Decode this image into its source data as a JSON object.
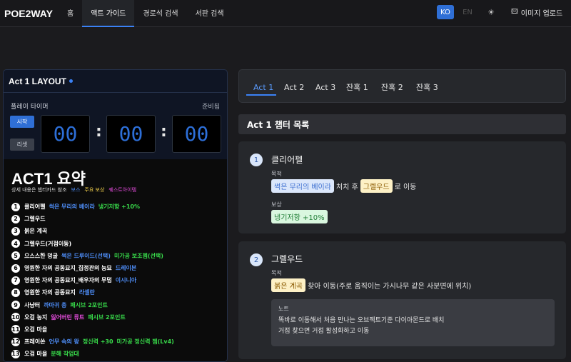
{
  "nav": {
    "brand": "POE2WAY",
    "tabs": [
      "홈",
      "액트 가이드",
      "경로석 검색",
      "서판 검색"
    ],
    "lang_ko": "KO",
    "lang_en": "EN",
    "upload": "이미지 업로드"
  },
  "layout": {
    "title": "Act 1 LAYOUT",
    "timer_label": "플레이 타이머",
    "ready": "준비됨",
    "start": "시작",
    "reset": "리셋",
    "hours": "00",
    "minutes": "00",
    "seconds": "00",
    "colon": ":"
  },
  "summary": {
    "title": "ACT1 요약",
    "subtitle": "상세 내용은 챕터카드 참조",
    "legend_boss": "보스",
    "legend_reward": "주요 보상",
    "legend_quest": "퀘스트아이템",
    "steps": [
      {
        "n": "1",
        "name": "클리어펠",
        "b": "썩은 무리의 베이라",
        "g": "냉기저항 +10%"
      },
      {
        "n": "2",
        "name": "그렐우드"
      },
      {
        "n": "3",
        "name": "붉은 계곡"
      },
      {
        "n": "4",
        "name": "그렐우드(거점이동)"
      },
      {
        "n": "5",
        "name": "으스스한 덩굴",
        "b": "썩은 드루이드(선택)",
        "g": "미가공 보조젬(선택)"
      },
      {
        "n": "6",
        "name": "영원한 자의 공동묘지_집정관의 능묘",
        "b": "드레이븐"
      },
      {
        "n": "7",
        "name": "영원한 자의 공동묘지_배우자의 무덤",
        "b": "이시니아"
      },
      {
        "n": "8",
        "name": "영원한 자의 공동묘지",
        "b": "라셀란"
      },
      {
        "n": "9",
        "name": "사냥터",
        "b": "까마귀 총",
        "g": "패시브 2포인트"
      },
      {
        "n": "10",
        "name": "오검 농지",
        "p": "잃어버린 류트",
        "g": "패시브 2포인트"
      },
      {
        "n": "11",
        "name": "오검 마을"
      },
      {
        "n": "12",
        "name": "프레이쏜",
        "b": "언무 속의 왕",
        "g": "정신력 +30",
        "g2": "미가공 정신력 젬(Lv4)"
      },
      {
        "n": "13",
        "name": "오검 마을",
        "g": "분해 작업대"
      }
    ]
  },
  "acts": {
    "tabs": [
      "Act 1",
      "Act 2",
      "Act 3",
      "잔혹 1",
      "잔혹 2",
      "잔혹 3"
    ],
    "active": "Act 1"
  },
  "chapter_header": "Act 1 챕터 목록",
  "chapters": [
    {
      "num": "1",
      "title": "클리어펠",
      "goal_label": "목적",
      "goal_tag1": "썩은 무리의 베이라",
      "goal_mid": "처치 후",
      "goal_tag2": "그렐우드",
      "goal_end": "로 이동",
      "reward_label": "보상",
      "reward": "냉기저항 +10%"
    },
    {
      "num": "2",
      "title": "그렐우드",
      "goal_label": "목적",
      "goal_tag": "붉은 계곡",
      "goal_text": "찾아 이동(주로 움직이는 가시나무 같은 사분면에 위치)",
      "note_label": "노트",
      "note_line1": "똑바로 이동해서 처음 만나는 오브젝트기준 다이아몬드로 배치",
      "note_line2": "거점 찾으면 거점 활성화하고 이동"
    }
  ],
  "colors": {
    "accent": "#3b82f6",
    "boss": "#4d8cf5",
    "reward": "#38d94a",
    "quest": "#e14bd9",
    "legend_reward": "#f5d34d"
  }
}
